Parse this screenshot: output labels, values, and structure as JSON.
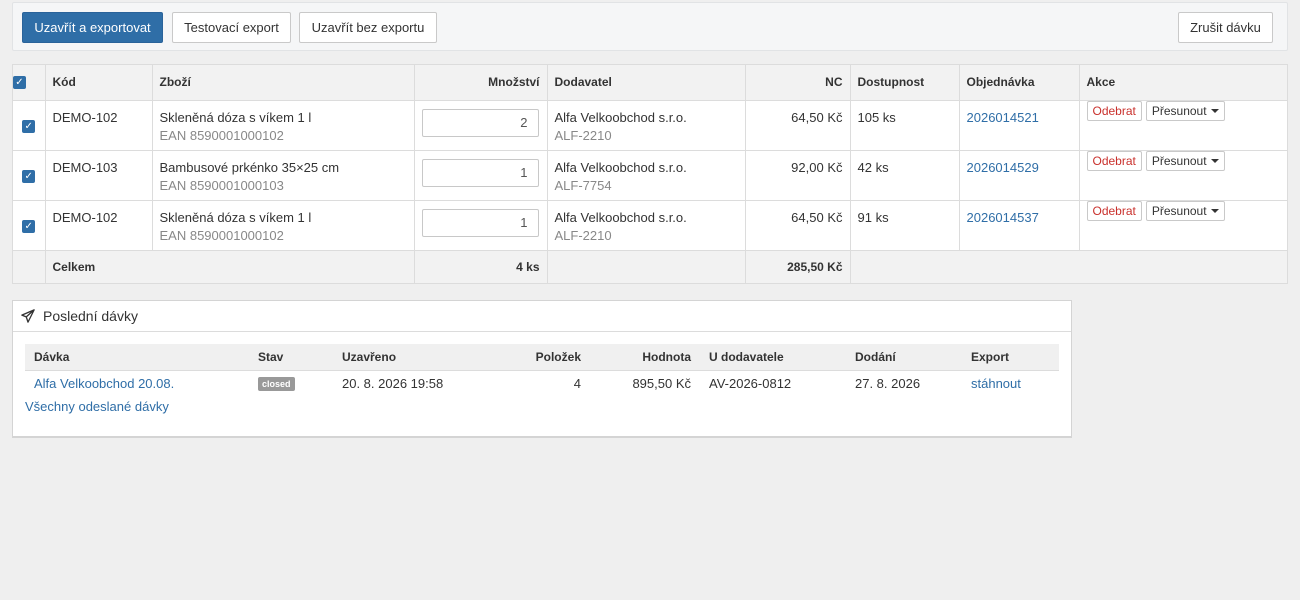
{
  "toolbar": {
    "close_export": "Uzavřít a exportovat",
    "test_export": "Testovací export",
    "close_no_export": "Uzavřít bez exportu",
    "cancel_batch": "Zrušit dávku"
  },
  "items_table": {
    "columns": {
      "code": "Kód",
      "goods": "Zboží",
      "quantity": "Množství",
      "supplier": "Dodavatel",
      "nc": "NC",
      "availability": "Dostupnost",
      "order": "Objednávka",
      "action": "Akce"
    },
    "all_checked": true,
    "rows": [
      {
        "checked": true,
        "code": "DEMO-102",
        "name": "Skleněná dóza s víkem 1 l",
        "ean": "EAN 8590001000102",
        "quantity": "2",
        "supplier": "Alfa Velkoobchod s.r.o.",
        "supplier_code": "ALF-2210",
        "nc": "64,50 Kč",
        "availability": "105 ks",
        "order": "2026014521",
        "remove": "Odebrat",
        "move": "Přesunout"
      },
      {
        "checked": true,
        "code": "DEMO-103",
        "name": "Bambusové prkénko 35×25 cm",
        "ean": "EAN 8590001000103",
        "quantity": "1",
        "supplier": "Alfa Velkoobchod s.r.o.",
        "supplier_code": "ALF-7754",
        "nc": "92,00 Kč",
        "availability": "42 ks",
        "order": "2026014529",
        "remove": "Odebrat",
        "move": "Přesunout"
      },
      {
        "checked": true,
        "code": "DEMO-102",
        "name": "Skleněná dóza s víkem 1 l",
        "ean": "EAN 8590001000102",
        "quantity": "1",
        "supplier": "Alfa Velkoobchod s.r.o.",
        "supplier_code": "ALF-2210",
        "nc": "64,50 Kč",
        "availability": "91 ks",
        "order": "2026014537",
        "remove": "Odebrat",
        "move": "Přesunout"
      }
    ],
    "total": {
      "label": "Celkem",
      "quantity": "4 ks",
      "nc": "285,50 Kč"
    }
  },
  "recent": {
    "title": "Poslední dávky",
    "icon": "paper-plane-icon",
    "columns": {
      "batch": "Dávka",
      "state": "Stav",
      "closed_at": "Uzavřeno",
      "items": "Položek",
      "value": "Hodnota",
      "at_supplier": "U dodavatele",
      "delivery": "Dodání",
      "export": "Export"
    },
    "rows": [
      {
        "batch": "Alfa Velkoobchod 20.08.",
        "state": "closed",
        "closed_at": "20. 8. 2026 19:58",
        "items": "4",
        "value": "895,50 Kč",
        "at_supplier": "AV-2026-0812",
        "delivery": "27. 8. 2026",
        "export": "stáhnout"
      }
    ],
    "all_link": "Všechny odeslané dávky"
  },
  "colors": {
    "primary": "#2f6ea7",
    "danger": "#c9302c",
    "badge": "#999999",
    "background": "#efefef"
  }
}
